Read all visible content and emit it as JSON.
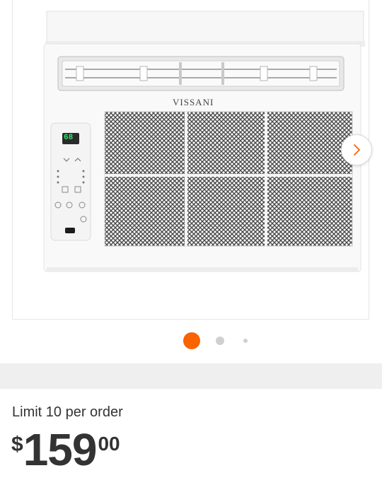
{
  "theme": {
    "accent": "#f96302",
    "inactive_dot": "#cfcfcf"
  },
  "gallery": {
    "brand_logo": "VISSANI",
    "display_readout": "68",
    "next_icon": "chevron-right-icon",
    "slides_total": 3,
    "active_slide": 1
  },
  "order": {
    "limit_text": "Limit 10 per order"
  },
  "price": {
    "currency": "$",
    "dollars": "159",
    "cents": "00"
  }
}
